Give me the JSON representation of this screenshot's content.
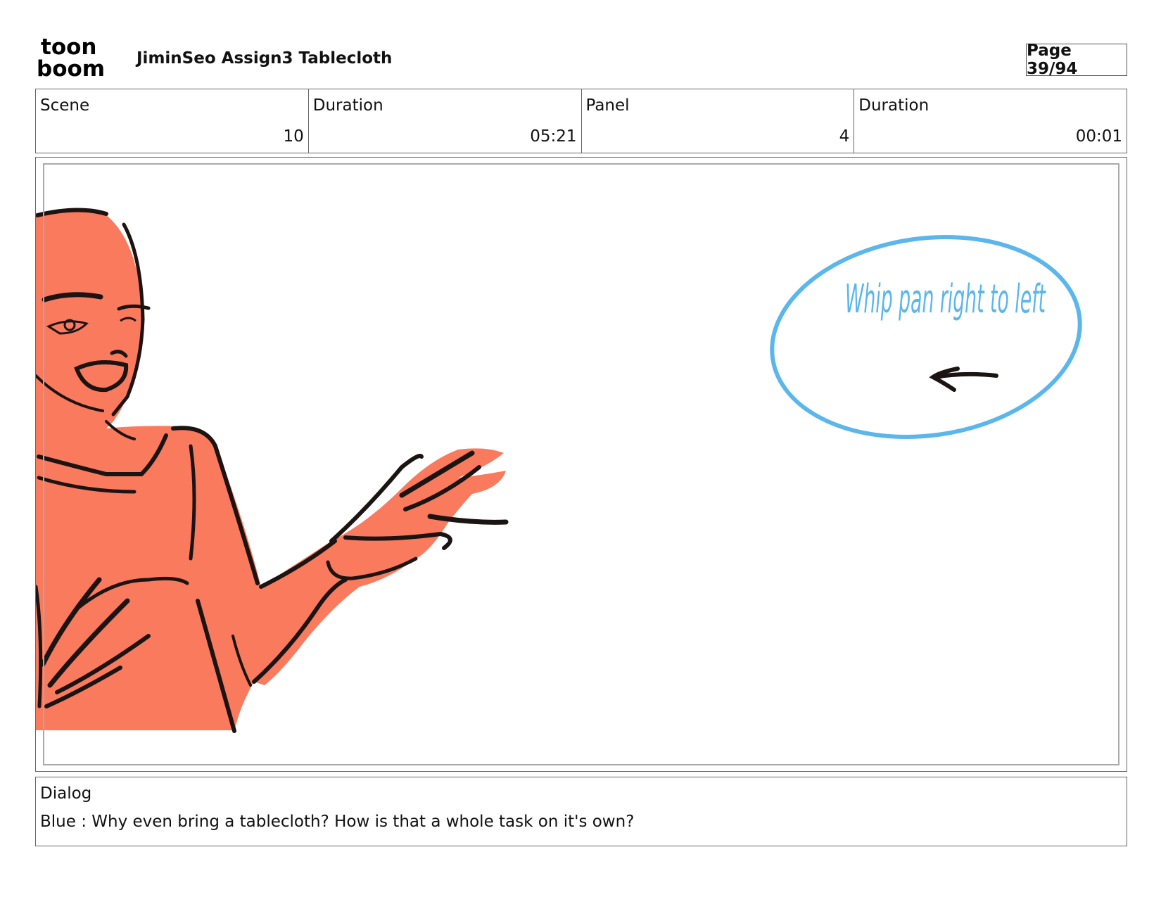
{
  "header": {
    "logo_text_top": "toon",
    "logo_text_bottom": "boom",
    "title": "JiminSeo Assign3 Tablecloth",
    "page": "Page 39/94"
  },
  "info": {
    "scene_label": "Scene",
    "scene_value": "10",
    "scene_duration_label": "Duration",
    "scene_duration_value": "05:21",
    "panel_label": "Panel",
    "panel_value": "4",
    "panel_duration_label": "Duration",
    "panel_duration_value": "00:01"
  },
  "panel": {
    "annotation": "Whip pan right to left",
    "annotation_color": "#5bb6ec",
    "skin_color": "#fa7a5e",
    "line_color": "#1c1412"
  },
  "dialog": {
    "label": "Dialog",
    "text": "Blue : Why even bring a tablecloth? How is that a whole task on it's own?"
  }
}
